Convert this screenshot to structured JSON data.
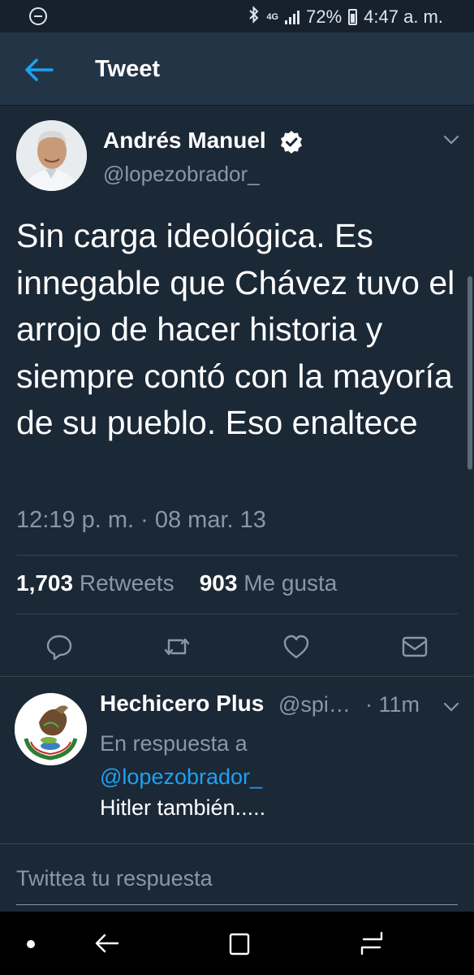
{
  "status_bar": {
    "network": "4G",
    "battery": "72%",
    "time": "4:47 a. m."
  },
  "header": {
    "title": "Tweet"
  },
  "tweet": {
    "author_name": "Andrés Manuel",
    "author_handle": "@lopezobrador_",
    "text": "Sin carga ideológica. Es innegable que Chávez tuvo el arrojo de hacer historia y siempre contó con la mayoría de su pueblo. Eso enaltece",
    "timestamp": "12:19 p. m. · 08 mar. 13",
    "retweet_count": "1,703",
    "retweet_label": "Retweets",
    "like_count": "903",
    "like_label": "Me gusta",
    "actions": [
      "reply-icon",
      "retweet-icon",
      "heart-icon",
      "mail-icon"
    ]
  },
  "reply": {
    "author_name": "Hechicero Plus",
    "author_handle": "@spi…",
    "time": "· 11m",
    "context_prefix": "En respuesta a ",
    "context_mention": "@lopezobrador_",
    "text": "Hitler también....."
  },
  "compose": {
    "placeholder": "Twittea tu respuesta"
  },
  "colors": {
    "background": "#1b2836",
    "header": "#243447",
    "secondary_text": "#8899a6",
    "link": "#1da1f2",
    "accent_verified": "#ffffff"
  }
}
